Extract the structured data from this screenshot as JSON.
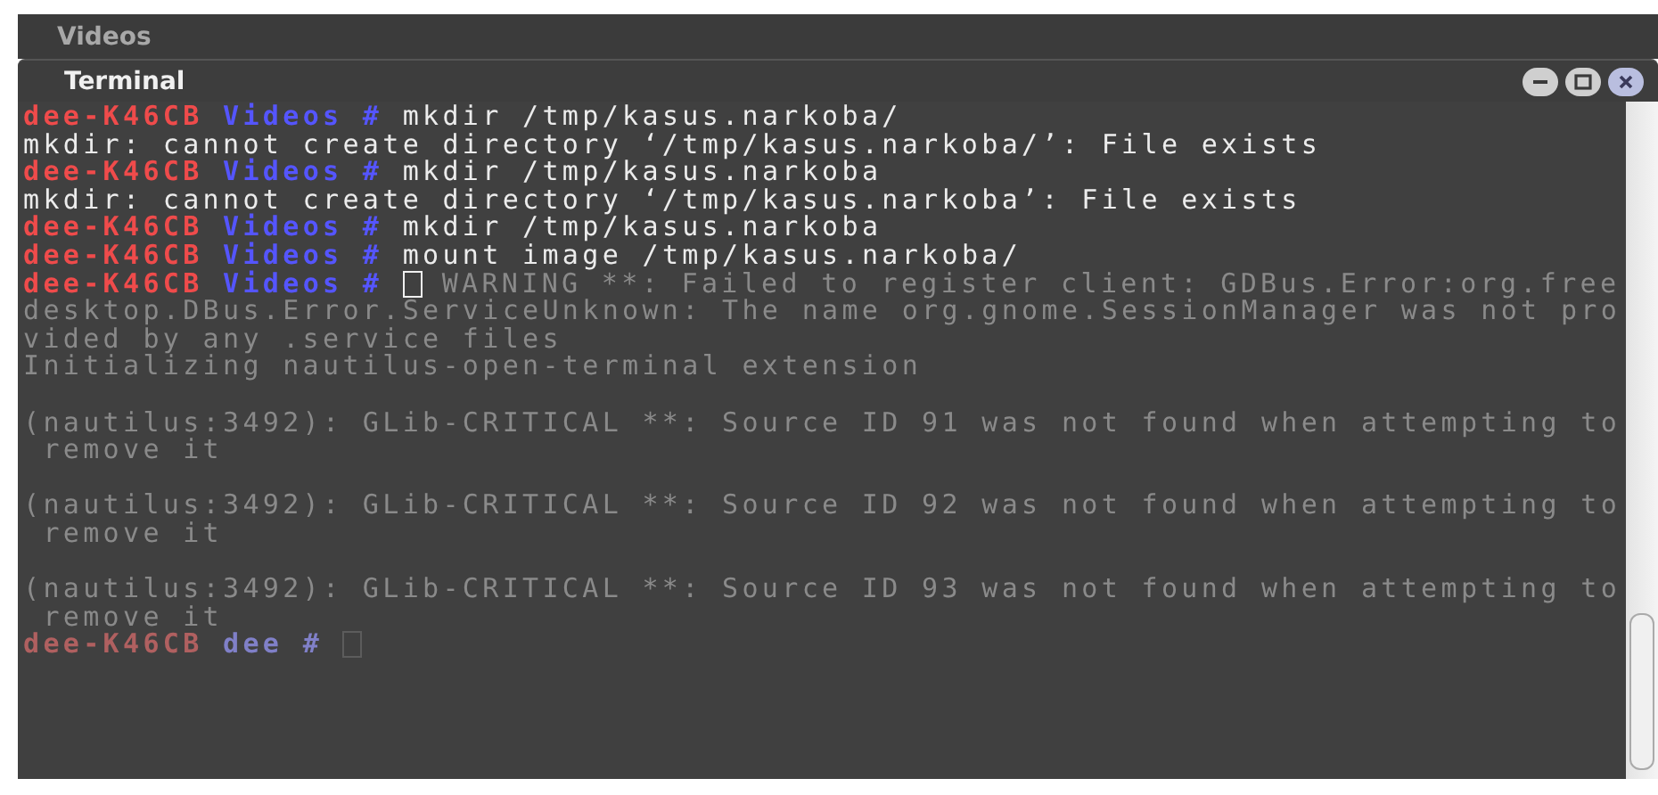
{
  "background_window": {
    "title": "Videos"
  },
  "terminal": {
    "title": "Terminal",
    "lines": [
      {
        "segments": [
          {
            "kind": "host",
            "text": "dee-K46CB"
          },
          {
            "kind": "dir",
            "text": "Videos #"
          },
          {
            "kind": "text",
            "text": "mkdir /tmp/kasus.narkoba/"
          }
        ]
      },
      {
        "segments": [
          {
            "kind": "text",
            "text": "mkdir: cannot create directory ‘/tmp/kasus.narkoba/’: File exists"
          }
        ]
      },
      {
        "segments": [
          {
            "kind": "host",
            "text": "dee-K46CB"
          },
          {
            "kind": "dir",
            "text": "Videos #"
          },
          {
            "kind": "text",
            "text": "mkdir /tmp/kasus.narkoba"
          }
        ]
      },
      {
        "segments": [
          {
            "kind": "text",
            "text": "mkdir: cannot create directory ‘/tmp/kasus.narkoba’: File exists"
          }
        ]
      },
      {
        "segments": [
          {
            "kind": "host",
            "text": "dee-K46CB"
          },
          {
            "kind": "dir",
            "text": "Videos #"
          },
          {
            "kind": "text",
            "text": "mkdir /tmp/kasus.narkoba"
          }
        ]
      },
      {
        "segments": [
          {
            "kind": "host",
            "text": "dee-K46CB"
          },
          {
            "kind": "dir",
            "text": "Videos #"
          },
          {
            "kind": "text",
            "text": "mount image /tmp/kasus.narkoba/"
          }
        ]
      },
      {
        "segments": [
          {
            "kind": "host",
            "text": "dee-K46CB"
          },
          {
            "kind": "dir",
            "text": "Videos #"
          },
          {
            "kind": "cursor"
          },
          {
            "kind": "faded",
            "text": "WARNING **: Failed to register client: GDBus.Error:org.free"
          }
        ]
      },
      {
        "segments": [
          {
            "kind": "faded",
            "text": "desktop.DBus.Error.ServiceUnknown: The name org.gnome.SessionManager was not pro"
          }
        ]
      },
      {
        "segments": [
          {
            "kind": "faded",
            "text": "vided by any .service files"
          }
        ]
      },
      {
        "segments": [
          {
            "kind": "faded",
            "text": "Initializing nautilus-open-terminal extension"
          }
        ]
      },
      {
        "blank_line_before": true,
        "segments": [
          {
            "kind": "faded",
            "text": "(nautilus:3492): GLib-CRITICAL **: Source ID 91 was not found when attempting to"
          }
        ]
      },
      {
        "segments": [
          {
            "kind": "faded",
            "text": " remove it"
          }
        ]
      },
      {
        "blank_line_before": true,
        "segments": [
          {
            "kind": "faded",
            "text": "(nautilus:3492): GLib-CRITICAL **: Source ID 92 was not found when attempting to"
          }
        ]
      },
      {
        "segments": [
          {
            "kind": "faded",
            "text": " remove it"
          }
        ]
      },
      {
        "blank_line_before": true,
        "segments": [
          {
            "kind": "faded",
            "text": "(nautilus:3492): GLib-CRITICAL **: Source ID 93 was not found when attempting to"
          }
        ]
      },
      {
        "segments": [
          {
            "kind": "faded",
            "text": " remove it"
          }
        ]
      },
      {
        "segments": [
          {
            "kind": "faded-host",
            "text": "dee-K46CB"
          },
          {
            "kind": "faded-dir",
            "text": "dee #"
          },
          {
            "kind": "faded-cursor"
          }
        ]
      }
    ]
  }
}
